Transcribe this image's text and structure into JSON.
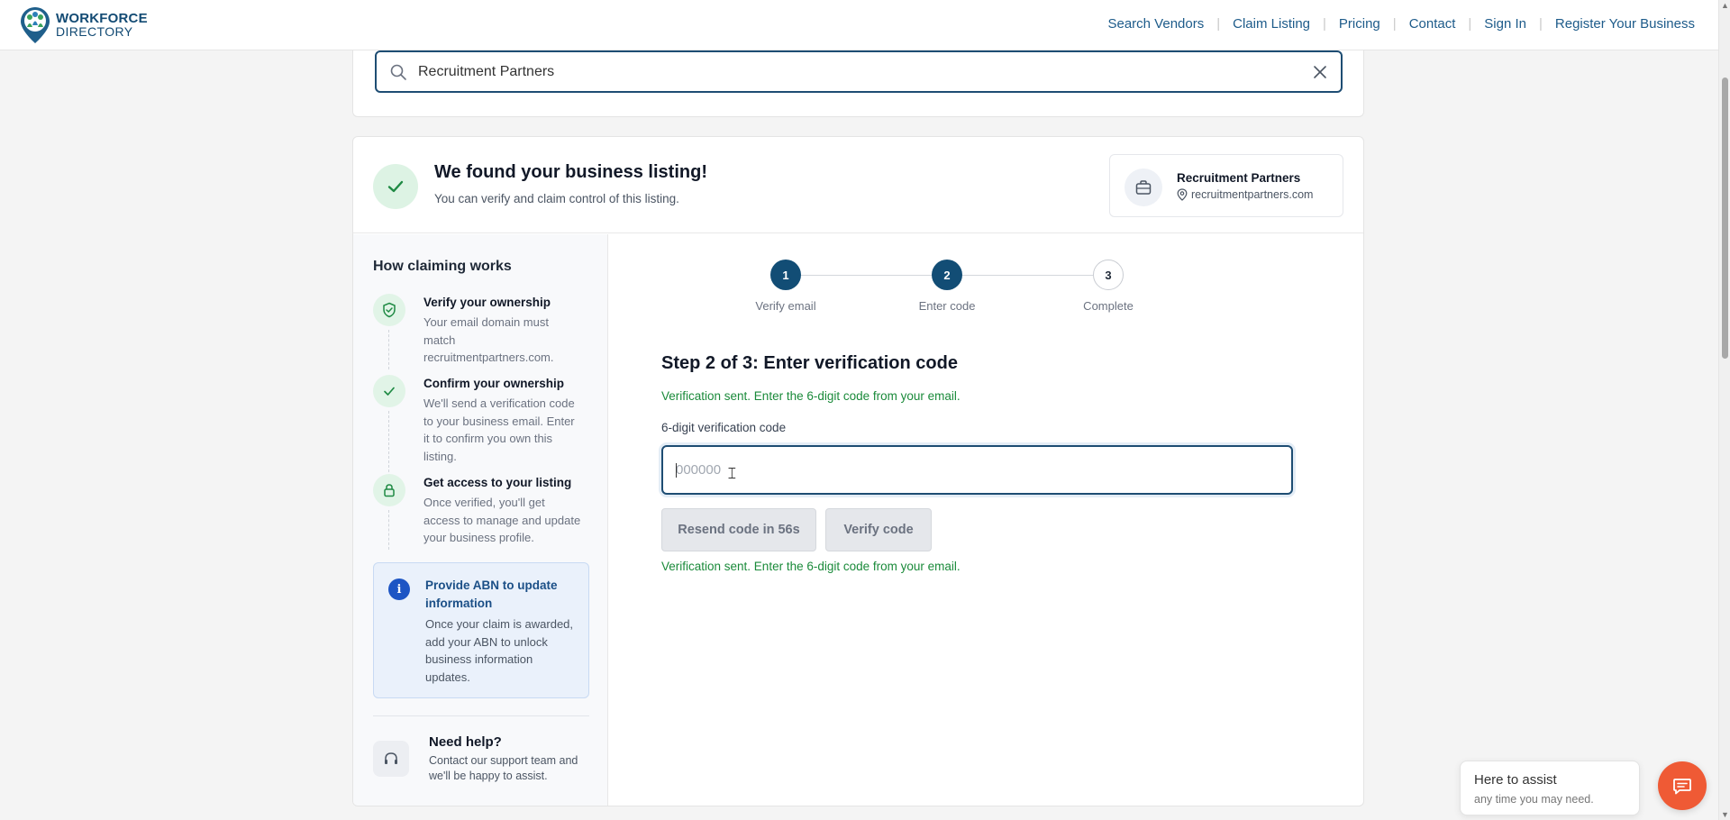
{
  "brand": {
    "line1": "WORKFORCE",
    "line2": "DIRECTORY"
  },
  "nav": {
    "items": [
      "Search Vendors",
      "Claim Listing",
      "Pricing",
      "Contact",
      "Sign In",
      "Register Your Business"
    ]
  },
  "search": {
    "value": "Recruitment Partners"
  },
  "found": {
    "title": "We found your business listing!",
    "subtitle": "You can verify and claim control of this listing.",
    "business_name": "Recruitment Partners",
    "business_url": "recruitmentpartners.com"
  },
  "sidebar": {
    "title": "How claiming works",
    "steps": [
      {
        "heading": "Verify your ownership",
        "text": "Your email domain must match recruitmentpartners.com.",
        "icon": "shield-check-icon"
      },
      {
        "heading": "Confirm your ownership",
        "text": "We'll send a verification code to your business email. Enter it to confirm you own this listing.",
        "icon": "check-icon"
      },
      {
        "heading": "Get access to your listing",
        "text": "Once verified, you'll get access to manage and update your business profile.",
        "icon": "lock-icon"
      }
    ],
    "abn": {
      "icon_text": "i",
      "title": "Provide ABN to update information",
      "text": "Once your claim is awarded, add your ABN to unlock business information updates."
    },
    "help": {
      "title": "Need help?",
      "text": "Contact our support team and we'll be happy to assist."
    }
  },
  "stepper": {
    "steps": [
      {
        "num": "1",
        "label": "Verify email",
        "state": "done"
      },
      {
        "num": "2",
        "label": "Enter code",
        "state": "current"
      },
      {
        "num": "3",
        "label": "Complete",
        "state": "todo"
      }
    ]
  },
  "form": {
    "title": "Step 2 of 3: Enter verification code",
    "message_top": "Verification sent. Enter the 6-digit code from your email.",
    "label": "6-digit verification code",
    "placeholder": "000000",
    "value": "",
    "resend_label": "Resend code in 56s",
    "verify_label": "Verify code",
    "message_bottom": "Verification sent. Enter the 6-digit code from your email."
  },
  "chat": {
    "title": "Here to assist",
    "subtitle": "any time you may need."
  },
  "colors": {
    "primary": "#124d75",
    "success": "#1a8a3a",
    "chat_button": "#ef5a35",
    "info": "#1d55c4"
  }
}
